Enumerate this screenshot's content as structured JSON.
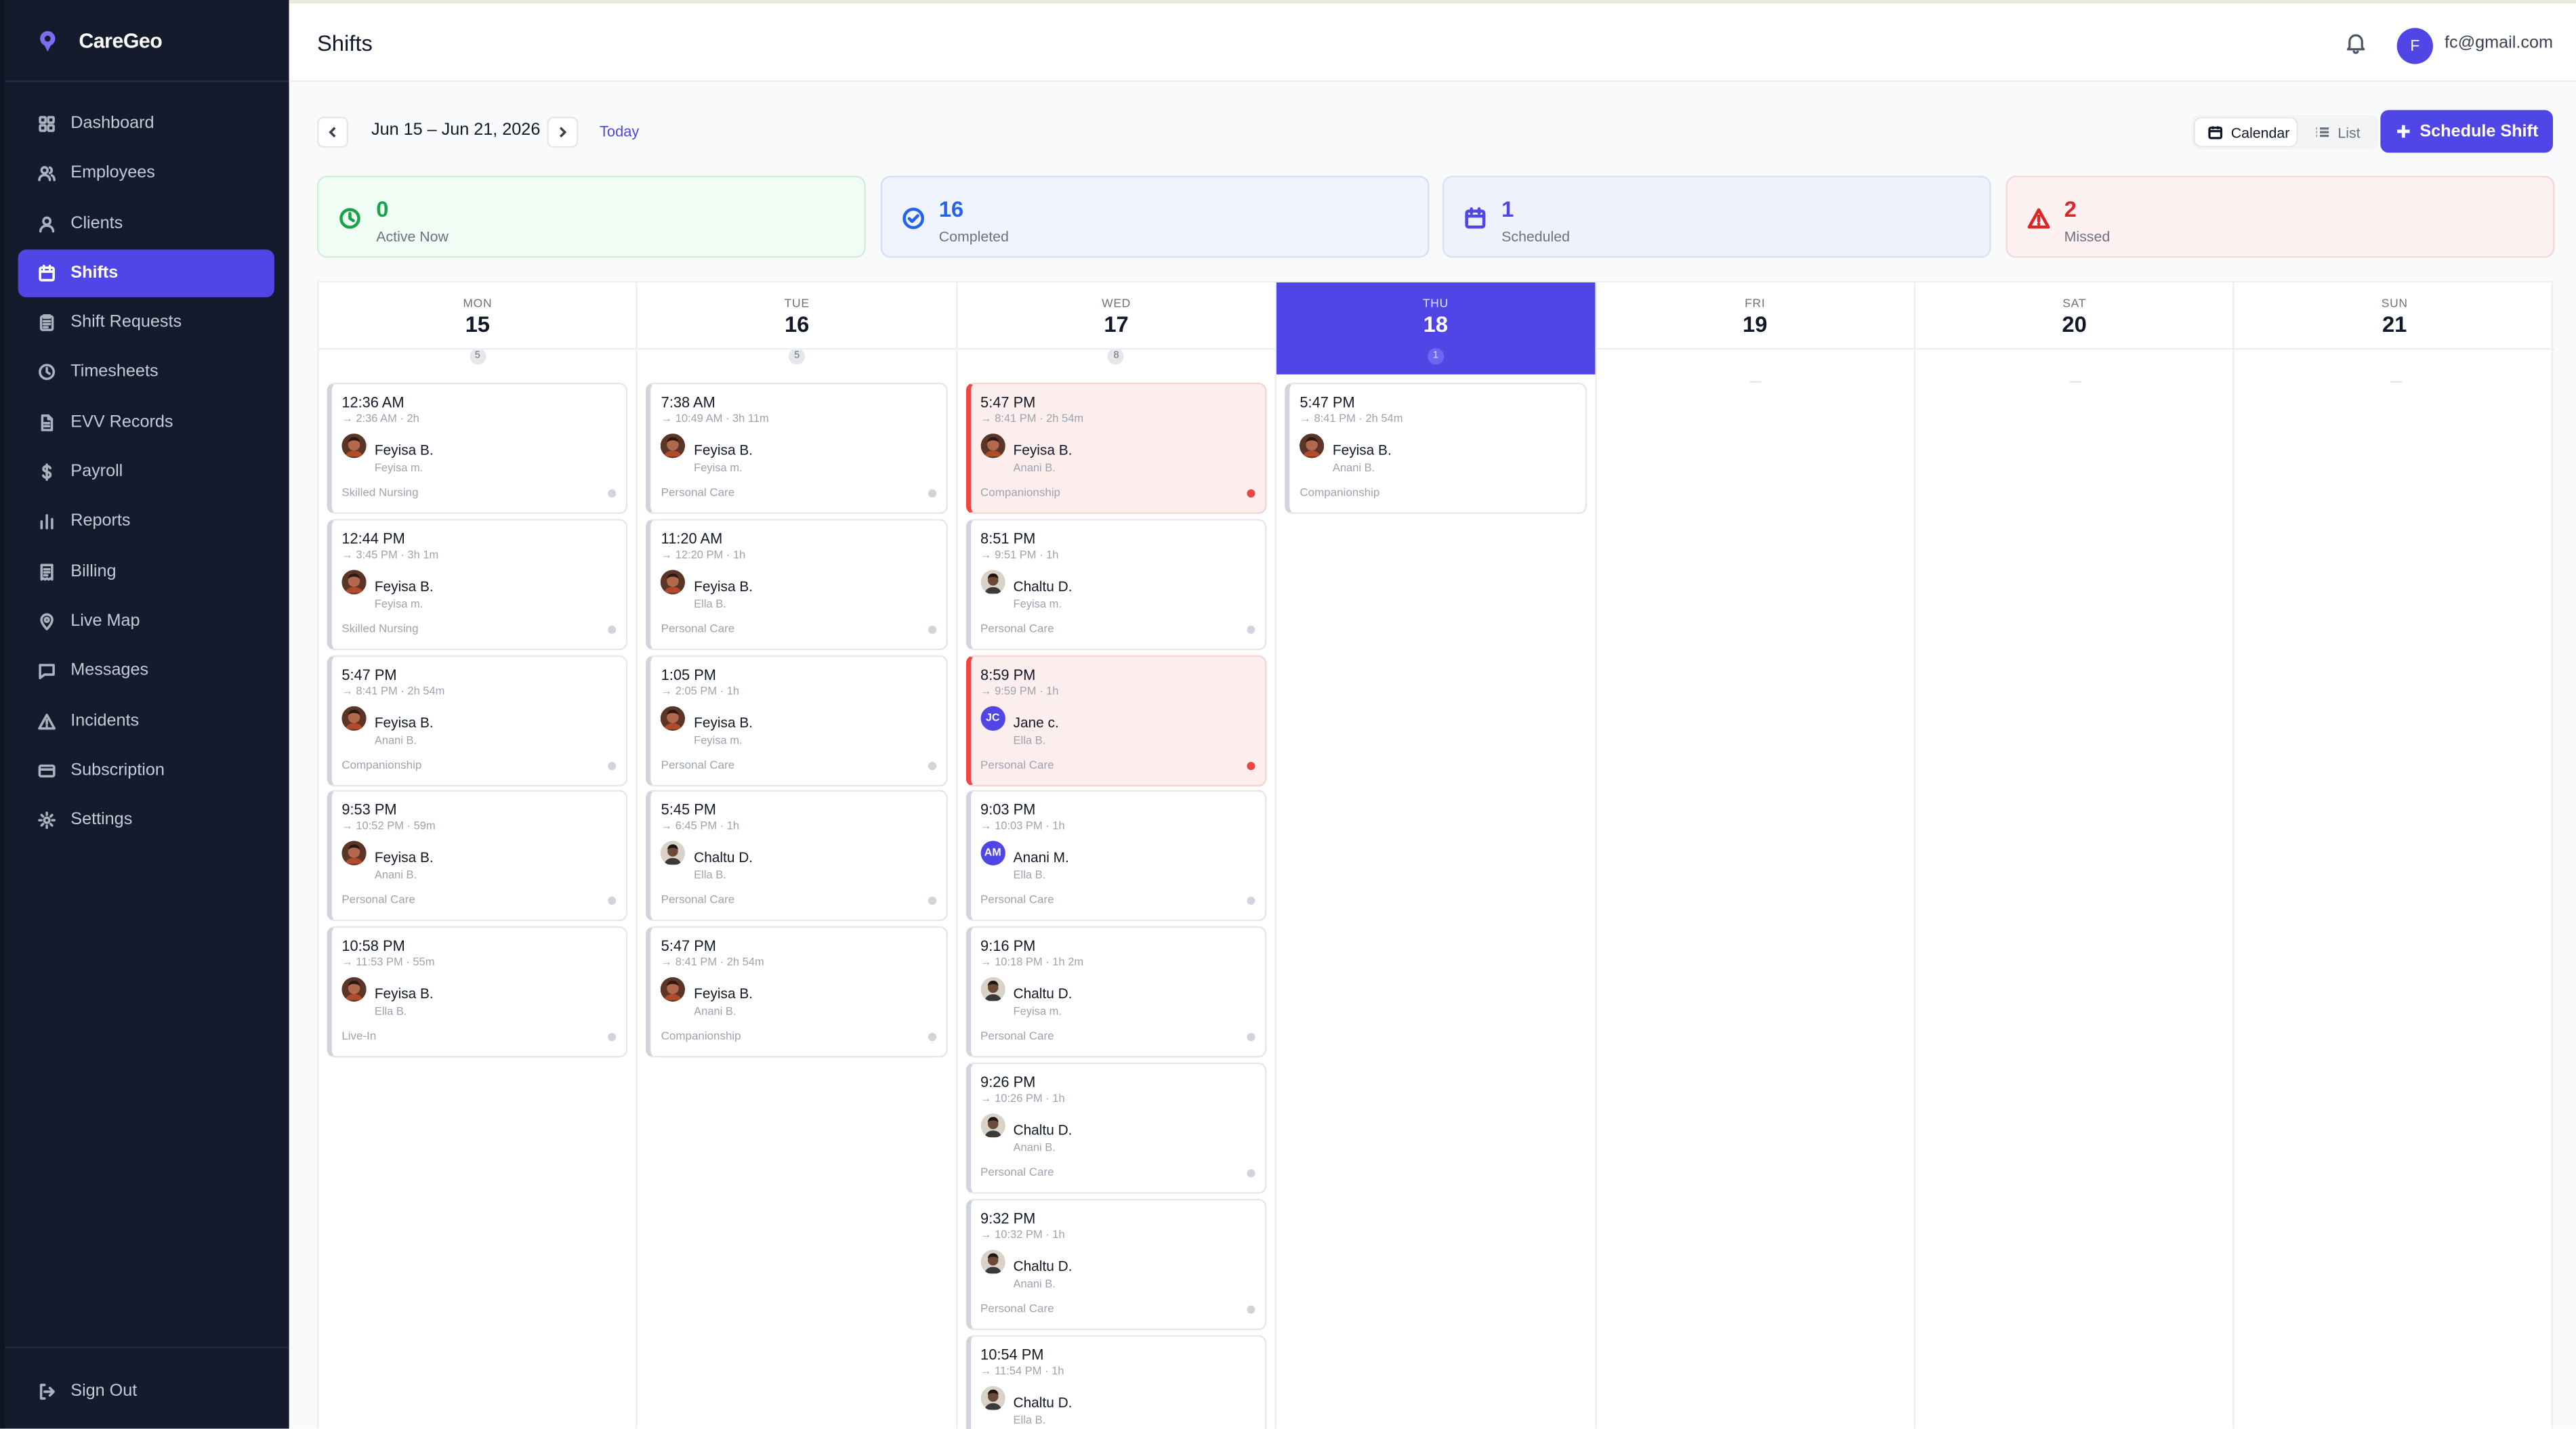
{
  "app": {
    "name": "CareGeo"
  },
  "sidebar": {
    "items": [
      {
        "label": "Dashboard",
        "icon": "grid-icon"
      },
      {
        "label": "Employees",
        "icon": "users-icon"
      },
      {
        "label": "Clients",
        "icon": "user-icon"
      },
      {
        "label": "Shifts",
        "icon": "calendar-icon",
        "active": true
      },
      {
        "label": "Shift Requests",
        "icon": "clipboard-icon"
      },
      {
        "label": "Timesheets",
        "icon": "clock-icon"
      },
      {
        "label": "EVV Records",
        "icon": "file-icon"
      },
      {
        "label": "Payroll",
        "icon": "dollar-icon"
      },
      {
        "label": "Reports",
        "icon": "bar-chart-icon"
      },
      {
        "label": "Billing",
        "icon": "receipt-icon"
      },
      {
        "label": "Live Map",
        "icon": "map-pin-icon"
      },
      {
        "label": "Messages",
        "icon": "message-icon"
      },
      {
        "label": "Incidents",
        "icon": "alert-triangle-icon"
      },
      {
        "label": "Subscription",
        "icon": "credit-card-icon"
      },
      {
        "label": "Settings",
        "icon": "gear-icon"
      }
    ],
    "signout": "Sign Out"
  },
  "header": {
    "title": "Shifts",
    "user_initial": "F",
    "user_email": "fc@gmail.com"
  },
  "toolbar": {
    "date_range": "Jun 15 – Jun 21, 2026",
    "today": "Today",
    "view_calendar": "Calendar",
    "view_list": "List",
    "schedule": "Schedule Shift"
  },
  "stats": [
    {
      "value": "0",
      "label": "Active Now",
      "color": "#16a34a",
      "bg": "#f0fdf4",
      "border": "#cfeedb",
      "icon": "clock-icon"
    },
    {
      "value": "16",
      "label": "Completed",
      "color": "#2563eb",
      "bg": "#eff4fe",
      "border": "#d3def8",
      "icon": "check-circle-icon"
    },
    {
      "value": "1",
      "label": "Scheduled",
      "color": "#4f46e5",
      "bg": "#eff1fd",
      "border": "#dcdff6",
      "icon": "calendar-icon"
    },
    {
      "value": "2",
      "label": "Missed",
      "color": "#dc2626",
      "bg": "#fef1f1",
      "border": "#f6d7d7",
      "icon": "alert-triangle-icon"
    }
  ],
  "days": [
    {
      "dow": "MON",
      "num": "15",
      "count": "5",
      "shifts": [
        {
          "time": "12:36 AM",
          "sub": "→ 2:36 AM · 2h",
          "employee": "Feyisa B.",
          "client": "Feyisa m.",
          "service": "Skilled Nursing",
          "avatar": "photo-a"
        },
        {
          "time": "12:44 PM",
          "sub": "→ 3:45 PM · 3h 1m",
          "employee": "Feyisa B.",
          "client": "Feyisa m.",
          "service": "Skilled Nursing",
          "avatar": "photo-a"
        },
        {
          "time": "5:47 PM",
          "sub": "→ 8:41 PM · 2h 54m",
          "employee": "Feyisa B.",
          "client": "Anani B.",
          "service": "Companionship",
          "avatar": "photo-a"
        },
        {
          "time": "9:53 PM",
          "sub": "→ 10:52 PM · 59m",
          "employee": "Feyisa B.",
          "client": "Anani B.",
          "service": "Personal Care",
          "avatar": "photo-a"
        },
        {
          "time": "10:58 PM",
          "sub": "→ 11:53 PM · 55m",
          "employee": "Feyisa B.",
          "client": "Ella B.",
          "service": "Live-In",
          "avatar": "photo-a"
        }
      ]
    },
    {
      "dow": "TUE",
      "num": "16",
      "count": "5",
      "shifts": [
        {
          "time": "7:38 AM",
          "sub": "→ 10:49 AM · 3h 11m",
          "employee": "Feyisa B.",
          "client": "Feyisa m.",
          "service": "Personal Care",
          "avatar": "photo-a"
        },
        {
          "time": "11:20 AM",
          "sub": "→ 12:20 PM · 1h",
          "employee": "Feyisa B.",
          "client": "Ella B.",
          "service": "Personal Care",
          "avatar": "photo-a"
        },
        {
          "time": "1:05 PM",
          "sub": "→ 2:05 PM · 1h",
          "employee": "Feyisa B.",
          "client": "Feyisa m.",
          "service": "Personal Care",
          "avatar": "photo-a"
        },
        {
          "time": "5:45 PM",
          "sub": "→ 6:45 PM · 1h",
          "employee": "Chaltu D.",
          "client": "Ella B.",
          "service": "Personal Care",
          "avatar": "photo-b"
        },
        {
          "time": "5:47 PM",
          "sub": "→ 8:41 PM · 2h 54m",
          "employee": "Feyisa B.",
          "client": "Anani B.",
          "service": "Companionship",
          "avatar": "photo-a"
        }
      ]
    },
    {
      "dow": "WED",
      "num": "17",
      "count": "8",
      "shifts": [
        {
          "time": "5:47 PM",
          "sub": "→ 8:41 PM · 2h 54m",
          "employee": "Feyisa B.",
          "client": "Anani B.",
          "service": "Companionship",
          "avatar": "photo-a",
          "missed": true
        },
        {
          "time": "8:51 PM",
          "sub": "→ 9:51 PM · 1h",
          "employee": "Chaltu D.",
          "client": "Feyisa m.",
          "service": "Personal Care",
          "avatar": "photo-b"
        },
        {
          "time": "8:59 PM",
          "sub": "→ 9:59 PM · 1h",
          "employee": "Jane c.",
          "client": "Ella B.",
          "service": "Personal Care",
          "avatar": "JC",
          "missed": true
        },
        {
          "time": "9:03 PM",
          "sub": "→ 10:03 PM · 1h",
          "employee": "Anani M.",
          "client": "Ella B.",
          "service": "Personal Care",
          "avatar": "AM"
        },
        {
          "time": "9:16 PM",
          "sub": "→ 10:18 PM · 1h 2m",
          "employee": "Chaltu D.",
          "client": "Feyisa m.",
          "service": "Personal Care",
          "avatar": "photo-b"
        },
        {
          "time": "9:26 PM",
          "sub": "→ 10:26 PM · 1h",
          "employee": "Chaltu D.",
          "client": "Anani B.",
          "service": "Personal Care",
          "avatar": "photo-b"
        },
        {
          "time": "9:32 PM",
          "sub": "→ 10:32 PM · 1h",
          "employee": "Chaltu D.",
          "client": "Anani B.",
          "service": "Personal Care",
          "avatar": "photo-b"
        },
        {
          "time": "10:54 PM",
          "sub": "→ 11:54 PM · 1h",
          "employee": "Chaltu D.",
          "client": "Ella B.",
          "service": "",
          "avatar": "photo-b"
        }
      ]
    },
    {
      "dow": "THU",
      "num": "18",
      "count": "1",
      "today": true,
      "shifts": [
        {
          "time": "5:47 PM",
          "sub": "→ 8:41 PM · 2h 54m",
          "employee": "Feyisa B.",
          "client": "Anani B.",
          "service": "Companionship",
          "avatar": "photo-a",
          "nodot": true
        }
      ]
    },
    {
      "dow": "FRI",
      "num": "19",
      "shifts": []
    },
    {
      "dow": "SAT",
      "num": "20",
      "shifts": []
    },
    {
      "dow": "SUN",
      "num": "21",
      "shifts": []
    }
  ]
}
